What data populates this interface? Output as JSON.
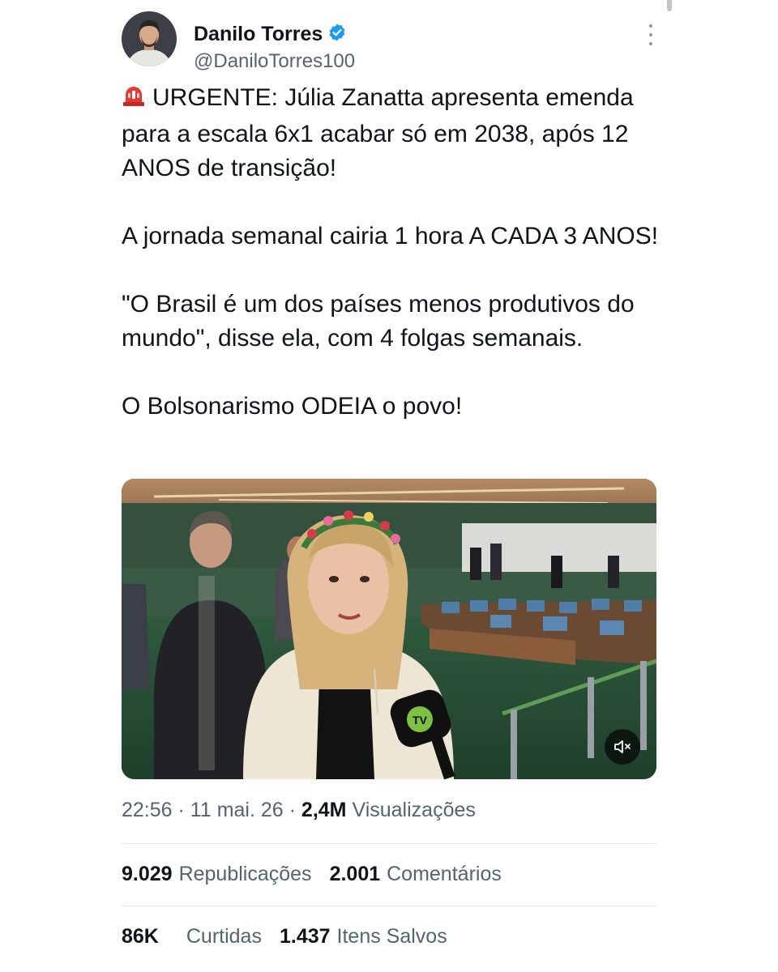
{
  "author": {
    "display_name": "Danilo Torres",
    "handle": "@DaniloTorres100",
    "verified": true,
    "verified_color": "#1d9bf0"
  },
  "tweet": {
    "emoji": "🚨",
    "paragraphs": [
      "URGENTE: Júlia Zanatta apresenta emenda para a escala 6x1 acabar só em 2038, após 12 ANOS de transição!",
      "A jornada semanal cairia 1 hora A CADA 3 ANOS!",
      "\"O Brasil é um dos países menos produtivos do mundo\", disse ela, com 4 folgas semanais.",
      "O Bolsonarismo ODEIA o povo!"
    ]
  },
  "media": {
    "type": "video",
    "icons": [
      "microphone-logo",
      "mute-icon"
    ],
    "muted": true
  },
  "meta": {
    "time": "22:56",
    "separator": "·",
    "date": "11 mai. 26",
    "views": "2,4M",
    "views_label": "Visualizações"
  },
  "stats": {
    "reposts": "9.029",
    "reposts_label": "Republicações",
    "comments": "2.001",
    "comments_label": "Comentários",
    "likes": "86K",
    "likes_label": "Curtidas",
    "bookmarks": "1.437",
    "bookmarks_label": "Itens Salvos"
  },
  "colors": {
    "text": "#0f1419",
    "secondary": "#536471",
    "divider": "#e1e6ea",
    "accent": "#1d9bf0"
  }
}
